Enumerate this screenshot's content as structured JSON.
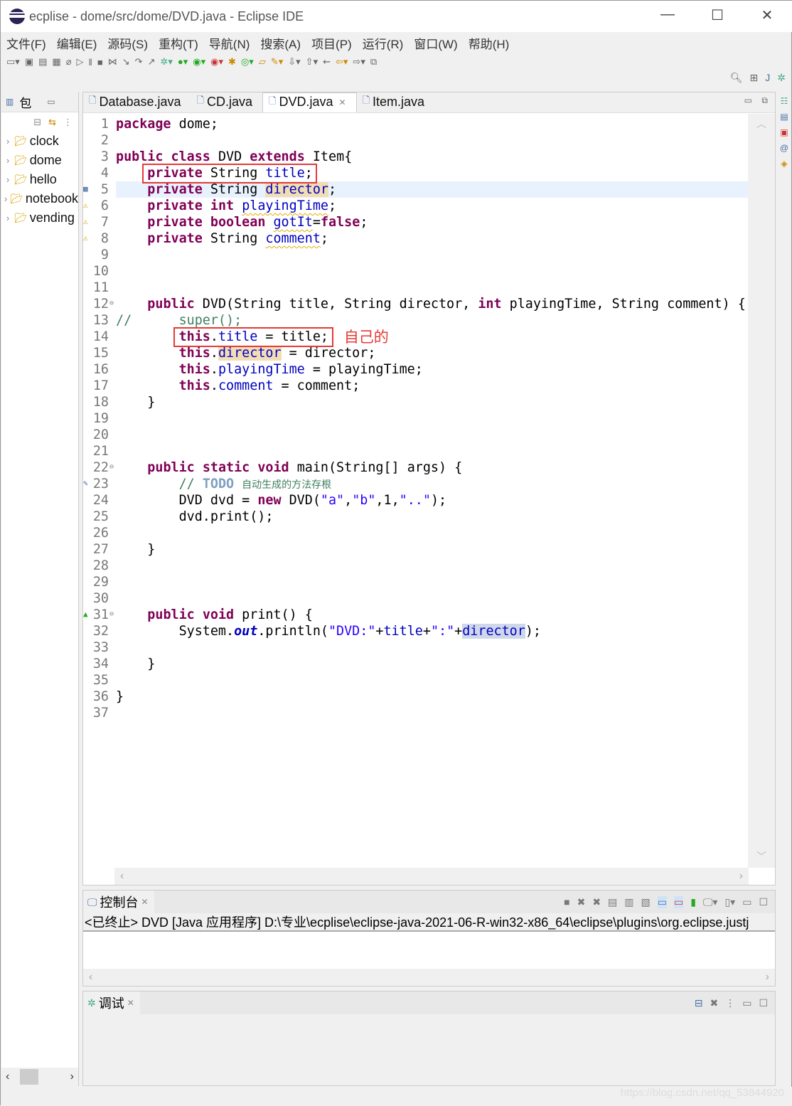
{
  "window": {
    "title": "ecplise - dome/src/dome/DVD.java - Eclipse IDE",
    "minimize": "—",
    "maximize": "☐",
    "close": "✕"
  },
  "menu": [
    "文件(F)",
    "编辑(E)",
    "源码(S)",
    "重构(T)",
    "导航(N)",
    "搜索(A)",
    "项目(P)",
    "运行(R)",
    "窗口(W)",
    "帮助(H)"
  ],
  "package_explorer": {
    "tab_label": "包",
    "items": [
      "clock",
      "dome",
      "hello",
      "notebook",
      "vending"
    ]
  },
  "editor": {
    "tabs": [
      {
        "label": "Database.java",
        "active": false
      },
      {
        "label": "CD.java",
        "active": false
      },
      {
        "label": "DVD.java",
        "active": true
      },
      {
        "label": "Item.java",
        "active": false
      }
    ],
    "current_line": 5,
    "annotation": "自己的",
    "lines": [
      [
        [
          "package",
          "kw"
        ],
        [
          " dome;",
          ""
        ]
      ],
      [],
      [
        [
          "public",
          "kw"
        ],
        [
          " ",
          ""
        ],
        [
          "class",
          "kw"
        ],
        [
          " DVD ",
          ""
        ],
        [
          "extends",
          "kw"
        ],
        [
          " Item{",
          ""
        ]
      ],
      [
        [
          "    ",
          ""
        ],
        [
          "private",
          "kw"
        ],
        [
          " String ",
          ""
        ],
        [
          "title",
          "fld"
        ],
        [
          ";",
          ""
        ]
      ],
      [
        [
          "    ",
          ""
        ],
        [
          "private",
          "kw"
        ],
        [
          " String ",
          ""
        ],
        [
          "director",
          "fld hl"
        ],
        [
          ";",
          ""
        ]
      ],
      [
        [
          "    ",
          ""
        ],
        [
          "private",
          "kw"
        ],
        [
          " ",
          ""
        ],
        [
          "int",
          "kw"
        ],
        [
          " ",
          ""
        ],
        [
          "playingTime",
          "fld warn"
        ],
        [
          ";",
          ""
        ]
      ],
      [
        [
          "    ",
          ""
        ],
        [
          "private",
          "kw"
        ],
        [
          " ",
          ""
        ],
        [
          "boolean",
          "kw"
        ],
        [
          " ",
          ""
        ],
        [
          "gotIt",
          "fld warn"
        ],
        [
          "=",
          ""
        ],
        [
          "false",
          "kw"
        ],
        [
          ";",
          ""
        ]
      ],
      [
        [
          "    ",
          ""
        ],
        [
          "private",
          "kw"
        ],
        [
          " String ",
          ""
        ],
        [
          "comment",
          "fld warn"
        ],
        [
          ";",
          ""
        ]
      ],
      [],
      [],
      [],
      [
        [
          "    ",
          ""
        ],
        [
          "public",
          "kw"
        ],
        [
          " DVD(String title, String director, ",
          ""
        ],
        [
          "int",
          "kw"
        ],
        [
          " playingTime, String comment) {",
          ""
        ]
      ],
      [
        [
          "//      super();",
          "cmt"
        ]
      ],
      [
        [
          "        ",
          ""
        ],
        [
          "this",
          "kw"
        ],
        [
          ".",
          ""
        ],
        [
          "title",
          "fld"
        ],
        [
          " = title;",
          ""
        ]
      ],
      [
        [
          "        ",
          ""
        ],
        [
          "this",
          "kw"
        ],
        [
          ".",
          ""
        ],
        [
          "director",
          "fld hl"
        ],
        [
          " = director;",
          ""
        ]
      ],
      [
        [
          "        ",
          ""
        ],
        [
          "this",
          "kw"
        ],
        [
          ".",
          ""
        ],
        [
          "playingTime",
          "fld"
        ],
        [
          " = playingTime;",
          ""
        ]
      ],
      [
        [
          "        ",
          ""
        ],
        [
          "this",
          "kw"
        ],
        [
          ".",
          ""
        ],
        [
          "comment",
          "fld"
        ],
        [
          " = comment;",
          ""
        ]
      ],
      [
        [
          "    }",
          ""
        ]
      ],
      [],
      [],
      [],
      [
        [
          "    ",
          ""
        ],
        [
          "public",
          "kw"
        ],
        [
          " ",
          ""
        ],
        [
          "static",
          "kw"
        ],
        [
          " ",
          ""
        ],
        [
          "void",
          "kw"
        ],
        [
          " main(String[] args) {",
          ""
        ]
      ],
      [
        [
          "        // ",
          "cmt"
        ],
        [
          "TODO",
          "todo"
        ],
        [
          " ",
          "cmt"
        ],
        [
          "自动生成的方法存根",
          "cjk"
        ]
      ],
      [
        [
          "        DVD dvd = ",
          ""
        ],
        [
          "new",
          "kw"
        ],
        [
          " DVD(",
          ""
        ],
        [
          "\"a\"",
          "str"
        ],
        [
          ",",
          ""
        ],
        [
          "\"b\"",
          "str"
        ],
        [
          ",1,",
          ""
        ],
        [
          "\"..\"",
          "str"
        ],
        [
          ");",
          ""
        ]
      ],
      [
        [
          "        dvd.print();",
          ""
        ]
      ],
      [],
      [
        [
          "    }",
          ""
        ]
      ],
      [],
      [],
      [],
      [
        [
          "    ",
          ""
        ],
        [
          "public",
          "kw"
        ],
        [
          " ",
          ""
        ],
        [
          "void",
          "kw"
        ],
        [
          " print() {",
          ""
        ]
      ],
      [
        [
          "        System.",
          ""
        ],
        [
          "out",
          "sfld"
        ],
        [
          ".println(",
          ""
        ],
        [
          "\"DVD:\"",
          "str"
        ],
        [
          "+",
          ""
        ],
        [
          "title",
          "fld"
        ],
        [
          "+",
          ""
        ],
        [
          "\":\"",
          "str"
        ],
        [
          "+",
          ""
        ],
        [
          "director",
          "fld sel"
        ],
        [
          ");",
          ""
        ]
      ],
      [],
      [
        [
          "    }",
          ""
        ]
      ],
      [],
      [
        [
          "}",
          ""
        ]
      ],
      []
    ]
  },
  "console": {
    "tab_label": "控制台",
    "path": "<已终止> DVD [Java 应用程序] D:\\专业\\ecplise\\eclipse-java-2021-06-R-win32-x86_64\\eclipse\\plugins\\org.eclipse.justj"
  },
  "debug": {
    "tab_label": "调试"
  },
  "watermark": "https://blog.csdn.net/qq_53844920"
}
